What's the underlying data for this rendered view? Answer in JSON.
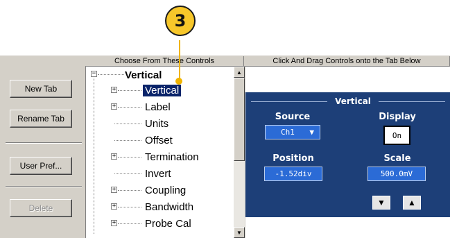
{
  "callout": {
    "number": "3"
  },
  "headers": {
    "left": "Choose From These Controls",
    "right": "Click And Drag Controls onto the Tab Below"
  },
  "buttons": {
    "new_tab": "New Tab",
    "rename_tab": "Rename Tab",
    "user_pref": "User Pref...",
    "delete": "Delete"
  },
  "tree": {
    "root": "Vertical",
    "items": [
      {
        "label": "Vertical",
        "expandable": true,
        "selected": true
      },
      {
        "label": "Label",
        "expandable": true
      },
      {
        "label": "Units",
        "expandable": false
      },
      {
        "label": "Offset",
        "expandable": false
      },
      {
        "label": "Termination",
        "expandable": true
      },
      {
        "label": "Invert",
        "expandable": false
      },
      {
        "label": "Coupling",
        "expandable": true
      },
      {
        "label": "Bandwidth",
        "expandable": true
      },
      {
        "label": "Probe Cal",
        "expandable": true
      }
    ]
  },
  "scrollbar": {
    "up": "▲",
    "down": "▼"
  },
  "vertical_panel": {
    "title": "Vertical",
    "source_label": "Source",
    "source_value": "Ch1",
    "display_label": "Display",
    "display_value": "On",
    "position_label": "Position",
    "position_value": "-1.52div",
    "scale_label": "Scale",
    "scale_value": "500.0mV",
    "down_arrow": "▼",
    "up_arrow": "▲"
  },
  "colors": {
    "panel_bg": "#1d3f78",
    "field_bg": "#2b6bd6",
    "selection": "#0a246a",
    "callout": "#f7c72a"
  }
}
